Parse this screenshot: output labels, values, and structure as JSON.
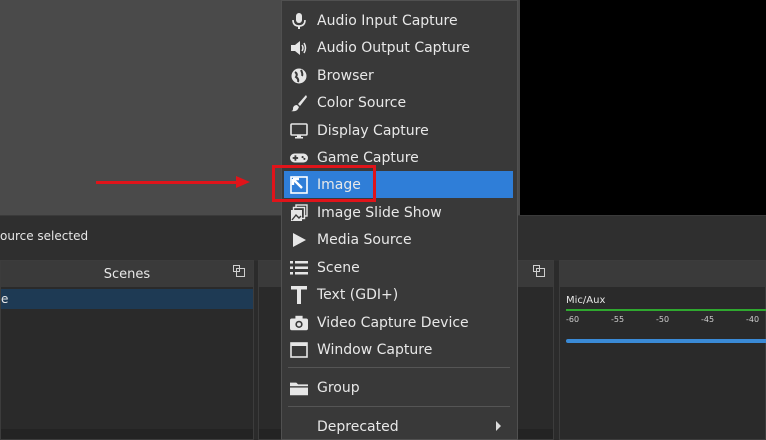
{
  "status": {
    "text": "ource selected"
  },
  "scenes_panel": {
    "title": "Scenes",
    "row_label": "e"
  },
  "mixer": {
    "track_label": "Mic/Aux",
    "scale": [
      "-60",
      "-55",
      "-50",
      "-45",
      "-40"
    ]
  },
  "context_menu": {
    "items": [
      {
        "label": "Audio Input Capture",
        "icon": "microphone-icon"
      },
      {
        "label": "Audio Output Capture",
        "icon": "speaker-icon"
      },
      {
        "label": "Browser",
        "icon": "globe-icon"
      },
      {
        "label": "Color Source",
        "icon": "paintbrush-icon"
      },
      {
        "label": "Display Capture",
        "icon": "monitor-icon"
      },
      {
        "label": "Game Capture",
        "icon": "gamepad-icon"
      },
      {
        "label": "Image",
        "icon": "image-icon",
        "selected": true
      },
      {
        "label": "Image Slide Show",
        "icon": "slideshow-icon"
      },
      {
        "label": "Media Source",
        "icon": "play-icon"
      },
      {
        "label": "Scene",
        "icon": "list-icon"
      },
      {
        "label": "Text (GDI+)",
        "icon": "text-icon"
      },
      {
        "label": "Video Capture Device",
        "icon": "camera-icon"
      },
      {
        "label": "Window Capture",
        "icon": "window-icon"
      }
    ],
    "group_label": "Group",
    "deprecated_label": "Deprecated"
  },
  "colors": {
    "selection": "#2f7ed8",
    "annotation_red": "#e0141a",
    "meter_green": "#2fa82f",
    "volume_blue": "#3a8ad6"
  }
}
